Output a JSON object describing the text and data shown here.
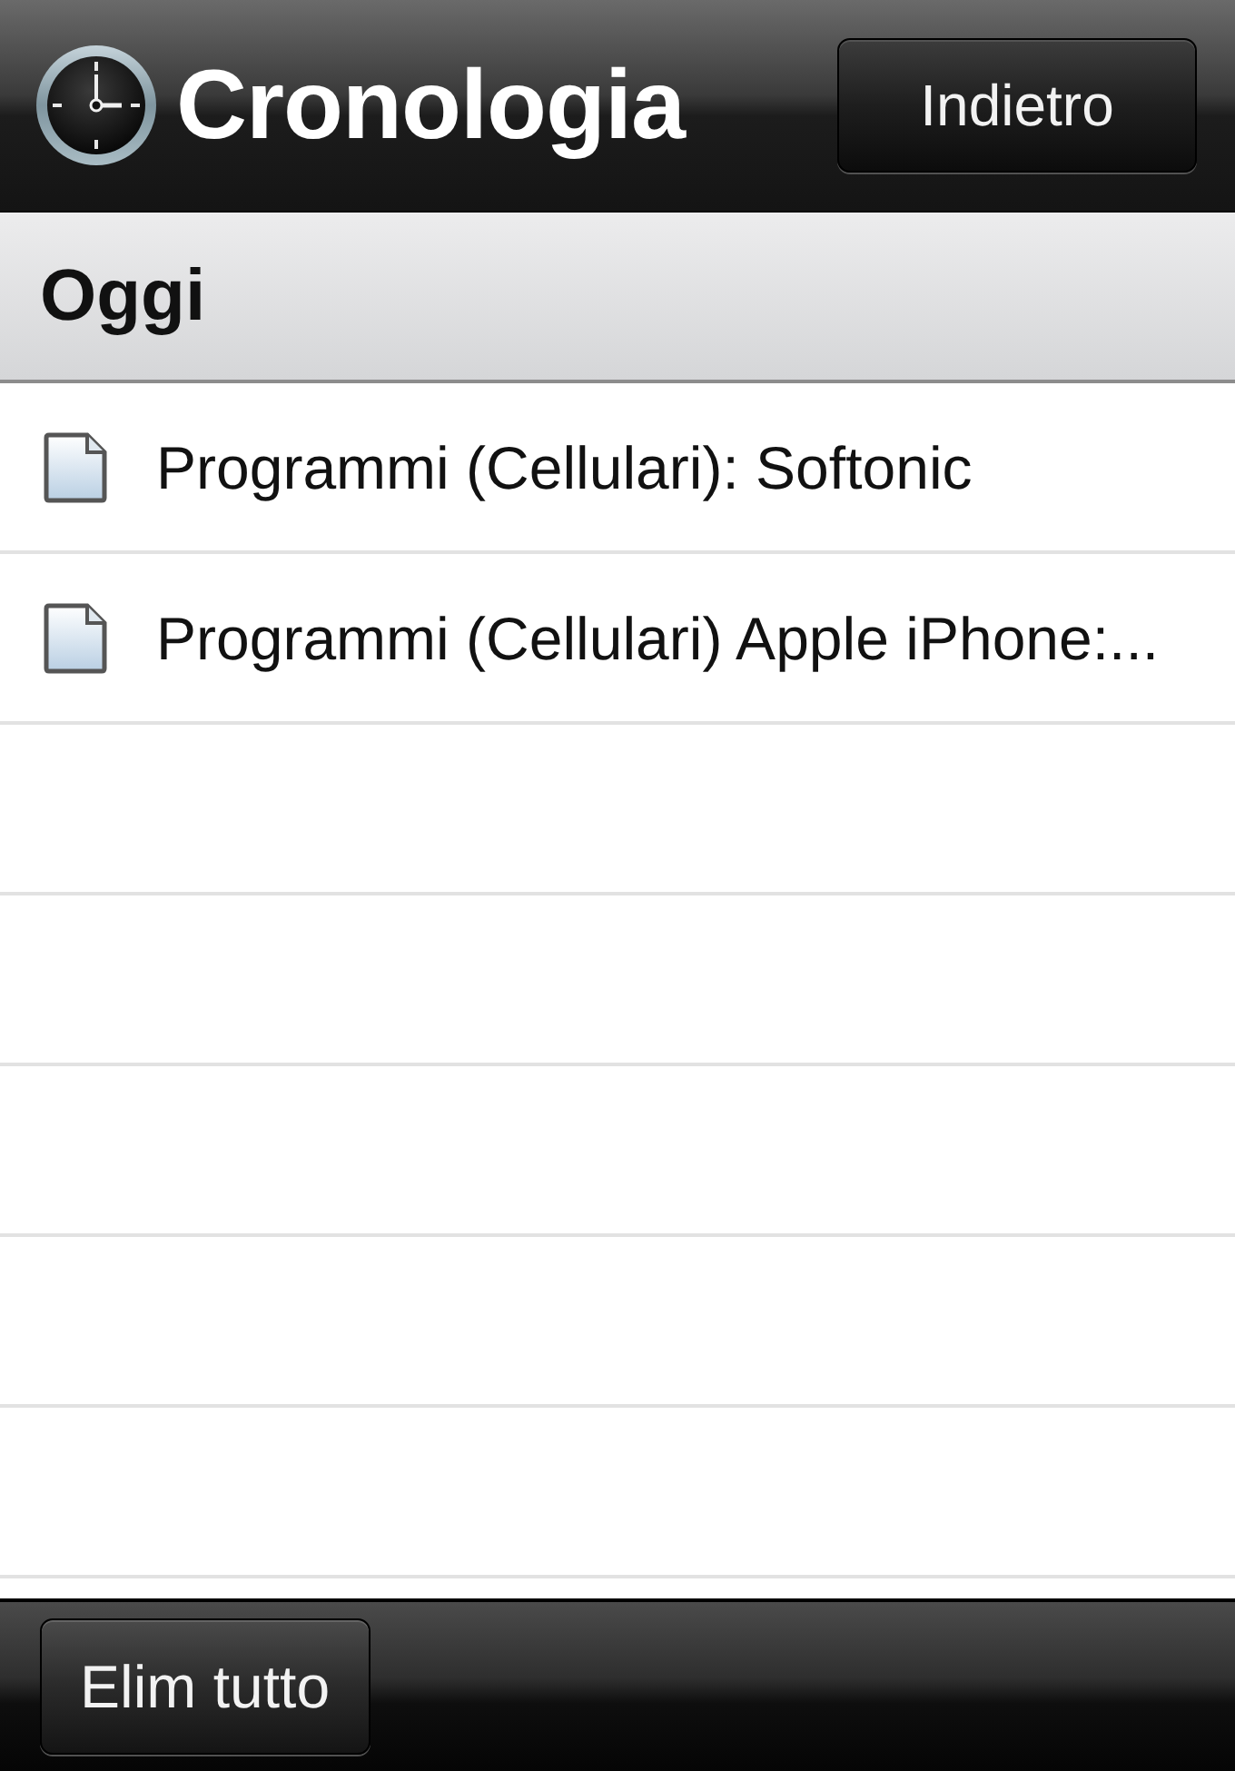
{
  "nav_bar": {
    "title": "Cronologia",
    "back_button": "Indietro"
  },
  "section": {
    "title": "Oggi"
  },
  "history_items": [
    {
      "title": "Programmi (Cellulari): Softonic"
    },
    {
      "title": "Programmi (Cellulari) Apple iPhone:..."
    }
  ],
  "toolbar": {
    "buttons": [
      "Elim tutto"
    ]
  }
}
